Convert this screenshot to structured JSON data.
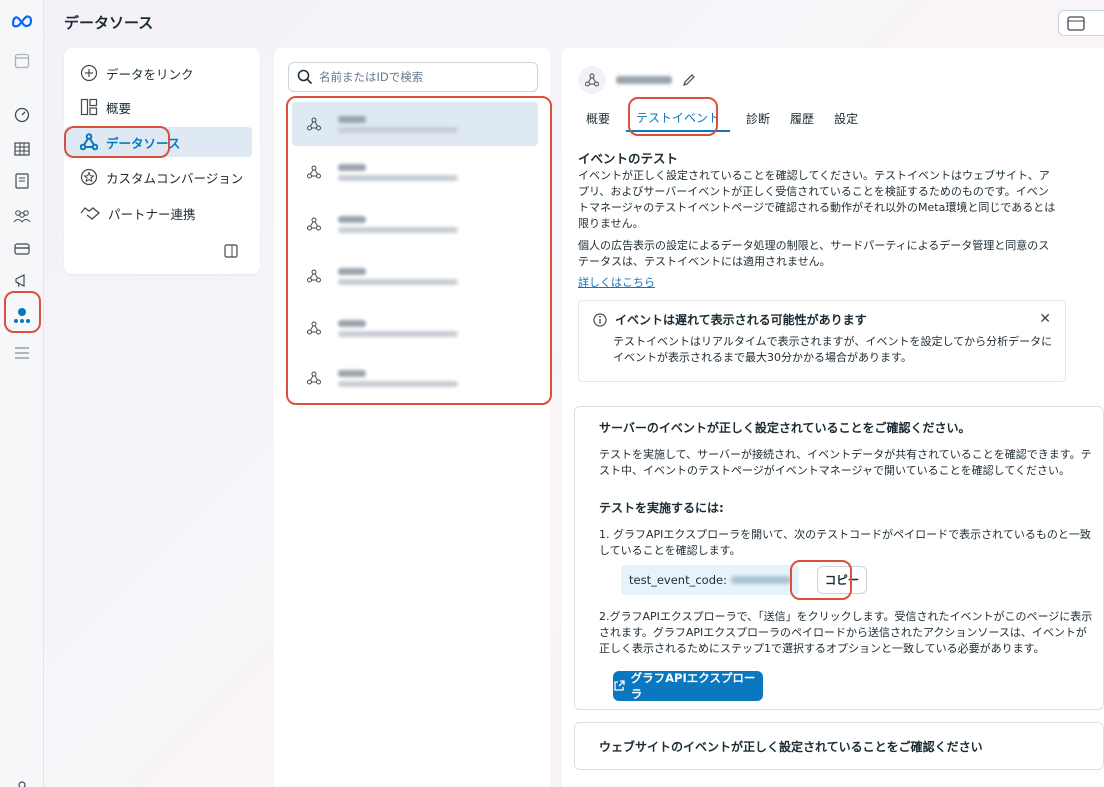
{
  "page_title": "データソース",
  "nav": {
    "add_link": "データをリンク",
    "items": [
      {
        "label": "概要"
      },
      {
        "label": "データソース"
      },
      {
        "label": "カスタムコンバージョン"
      },
      {
        "label": "パートナー連携"
      }
    ]
  },
  "search": {
    "placeholder": "名前またはIDで検索"
  },
  "detail": {
    "tabs": [
      "概要",
      "テストイベント",
      "診断",
      "履歴",
      "設定"
    ],
    "section_title": "イベントのテスト",
    "para1": "イベントが正しく設定されていることを確認してください。テストイベントはウェブサイト、アプリ、およびサーバーイベントが正しく受信されていることを検証するためのものです。イベントマネージャのテストイベントページで確認される動作がそれ以外のMeta環境と同じであるとは限りません。",
    "para2": "個人の広告表示の設定によるデータ処理の制限と、サードパーティによるデータ管理と同意のステータスは、テストイベントには適用されません。",
    "learn_more": "詳しくはこちら",
    "notice_title": "イベントは遅れて表示される可能性があります",
    "notice_body": "テストイベントはリアルタイムで表示されますが、イベントを設定してから分析データにイベントが表示されるまで最大30分かかる場合があります。",
    "server_title": "サーバーのイベントが正しく設定されていることをご確認ください。",
    "server_para": "テストを実施して、サーバーが接続され、イベントデータが共有されていることを確認できます。テスト中、イベントのテストページがイベントマネージャで開いていることを確認してください。",
    "how_to_title": "テストを実施するには:",
    "step1": "1. グラフAPIエクスプローラを開いて、次のテストコードがペイロードで表示されているものと一致していることを確認します。",
    "code_label": "test_event_code:",
    "copy_label": "コピー",
    "step2": "2.グラフAPIエクスプローラで、「送信」をクリックします。受信されたイベントがこのページに表示されます。グラフAPIエクスプローラのペイロードから送信されたアクションソースは、イベントが正しく表示されるためにステップ1で選択するオプションと一致している必要があります。",
    "explorer_button": "グラフAPIエクスプローラ",
    "website_title": "ウェブサイトのイベントが正しく設定されていることをご確認ください"
  }
}
